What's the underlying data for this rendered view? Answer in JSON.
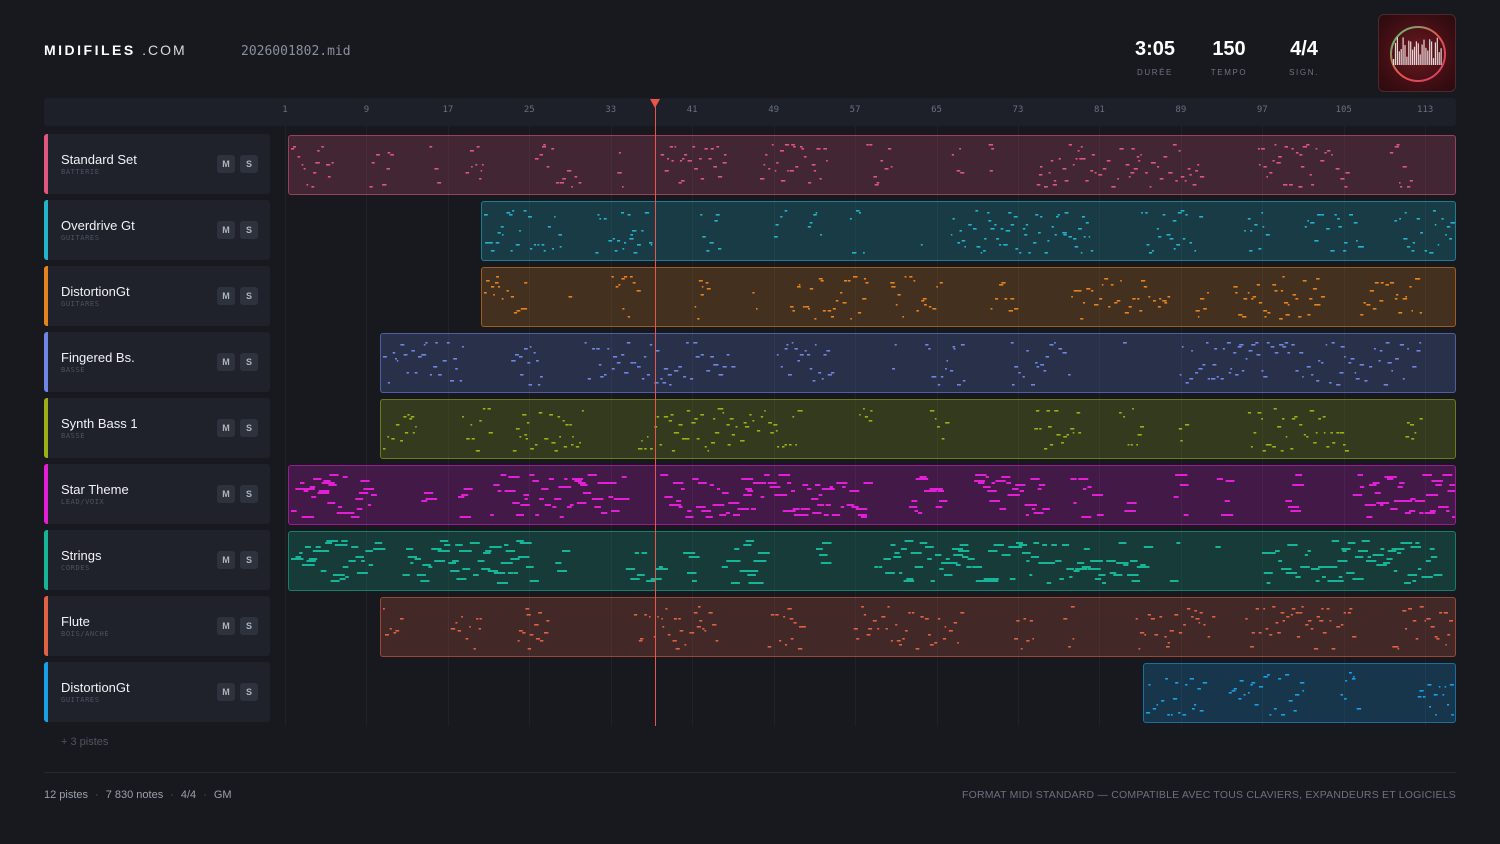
{
  "brand": {
    "name": "MIDIFILES",
    "domain": ".COM"
  },
  "file": {
    "name": "2026001802.mid"
  },
  "stats": [
    {
      "value": "3:05",
      "label": "DURÉE"
    },
    {
      "value": "150",
      "label": "TEMPO"
    },
    {
      "value": "4/4",
      "label": "SIGN."
    }
  ],
  "ruler": {
    "ticks": [
      "1",
      "9",
      "17",
      "25",
      "33",
      "41",
      "49",
      "57",
      "65",
      "73",
      "81",
      "89",
      "97",
      "105",
      "113"
    ]
  },
  "playhead": {
    "bar": 38
  },
  "colors": {
    "accent": "#e8564a",
    "background": "#17191f"
  },
  "tracks": [
    {
      "name": "Standard Set",
      "category": "BATTERIE",
      "color": "#e0577e",
      "mute": "M",
      "solo": "S"
    },
    {
      "name": "Overdrive Gt",
      "category": "GUITARES",
      "color": "#23b4cc",
      "mute": "M",
      "solo": "S"
    },
    {
      "name": "DistortionGt",
      "category": "GUITARES",
      "color": "#e7831f",
      "mute": "M",
      "solo": "S"
    },
    {
      "name": "Fingered Bs.",
      "category": "BASSE",
      "color": "#6f86e4",
      "mute": "M",
      "solo": "S"
    },
    {
      "name": "Synth Bass 1",
      "category": "BASSE",
      "color": "#9bb016",
      "mute": "M",
      "solo": "S"
    },
    {
      "name": "Star Theme",
      "category": "LEAD/VOIX",
      "color": "#e21ed6",
      "mute": "M",
      "solo": "S"
    },
    {
      "name": "Strings",
      "category": "CORDES",
      "color": "#17b597",
      "mute": "M",
      "solo": "S"
    },
    {
      "name": "Flute",
      "category": "BOIS/ANCHE",
      "color": "#e06143",
      "mute": "M",
      "solo": "S"
    },
    {
      "name": "DistortionGt",
      "category": "GUITARES",
      "color": "#1aa0e6",
      "mute": "M",
      "solo": "S"
    }
  ],
  "more_tracks": "+ 3 pistes",
  "footer": {
    "tracks": "12 pistes",
    "notes": "7 830 notes",
    "signature": "4/4",
    "standard": "GM",
    "tagline": "FORMAT MIDI STANDARD — COMPATIBLE AVEC TOUS CLAVIERS, EXPANDEURS ET LOGICIELS"
  }
}
